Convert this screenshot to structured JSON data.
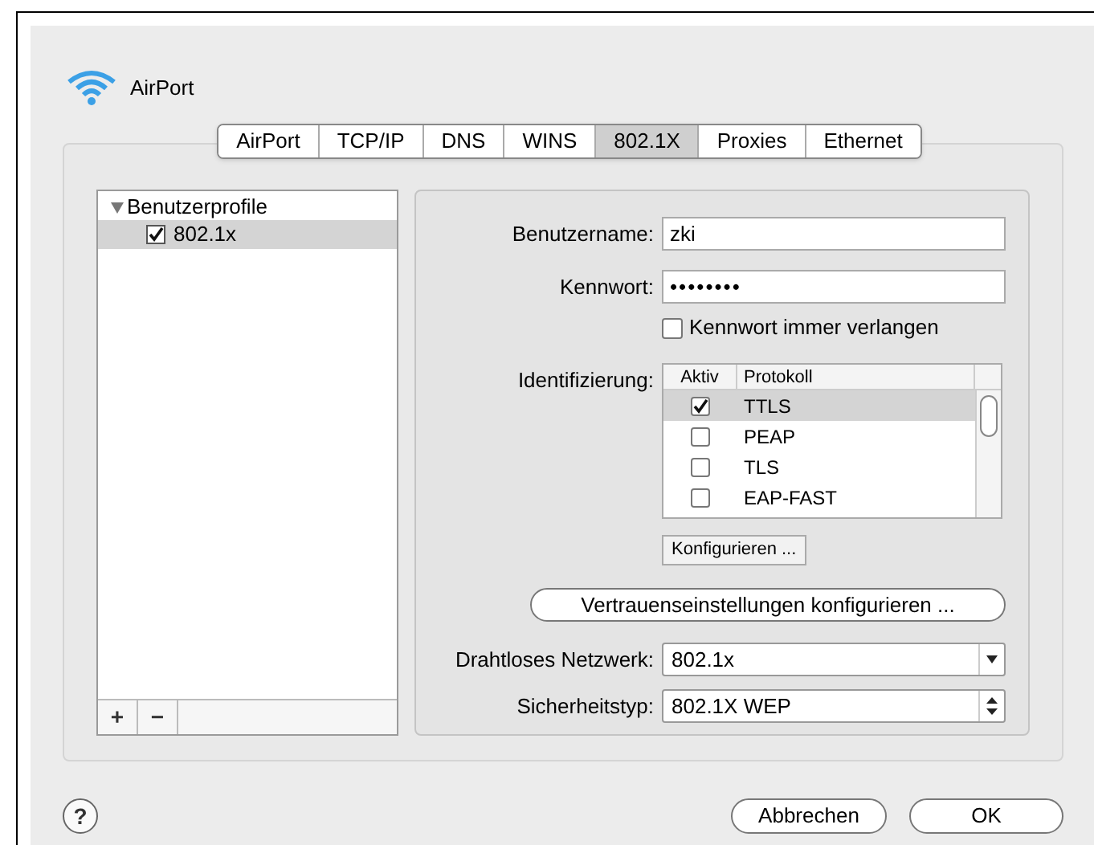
{
  "window": {
    "title": "AirPort"
  },
  "tabs": [
    {
      "label": "AirPort",
      "selected": false
    },
    {
      "label": "TCP/IP",
      "selected": false
    },
    {
      "label": "DNS",
      "selected": false
    },
    {
      "label": "WINS",
      "selected": false
    },
    {
      "label": "802.1X",
      "selected": true
    },
    {
      "label": "Proxies",
      "selected": false
    },
    {
      "label": "Ethernet",
      "selected": false
    }
  ],
  "profiles": {
    "header": "Benutzerprofile",
    "expanded": true,
    "items": [
      {
        "label": "802.1x",
        "checked": true,
        "selected": true
      }
    ]
  },
  "list_buttons": [
    "+",
    "−"
  ],
  "form": {
    "username_label": "Benutzername:",
    "username": "zki",
    "password_label": "Kennwort:",
    "password": "••••••••",
    "always_ask": {
      "label": "Kennwort immer verlangen",
      "checked": false
    },
    "auth_label": "Identifizierung:",
    "auth_columns": [
      "Aktiv",
      "Protokoll"
    ],
    "protocols": [
      {
        "name": "TTLS",
        "active": true,
        "selected": true
      },
      {
        "name": "PEAP",
        "active": false,
        "selected": false
      },
      {
        "name": "TLS",
        "active": false,
        "selected": false
      },
      {
        "name": "EAP-FAST",
        "active": false,
        "selected": false
      }
    ],
    "configure_button": "Konfigurieren ...",
    "trust_button": "Vertrauenseinstellungen konfigurieren ...",
    "network_label": "Drahtloses Netzwerk:",
    "network": "802.1x",
    "security_label": "Sicherheitstyp:",
    "security": "802.1X WEP"
  },
  "buttons": {
    "help": "?",
    "cancel": "Abbrechen",
    "ok": "OK"
  }
}
